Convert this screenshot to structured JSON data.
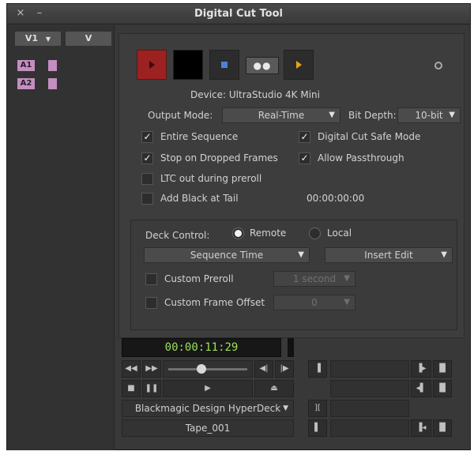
{
  "window": {
    "title": "Digital Cut Tool",
    "close_icon": "×",
    "minimize_icon": "–"
  },
  "tracks": {
    "video_button": "V1",
    "video_source": "V",
    "audio": [
      "A1",
      "A2"
    ]
  },
  "device": "Device: UltraStudio 4K Mini",
  "output_mode": {
    "label": "Output Mode:",
    "value": "Real-Time"
  },
  "bit_depth": {
    "label": "Bit Depth:",
    "value": "10-bit"
  },
  "options": {
    "entire_sequence": {
      "label": "Entire Sequence",
      "checked": true
    },
    "digital_cut_safe_mode": {
      "label": "Digital Cut Safe Mode",
      "checked": true
    },
    "stop_on_dropped_frames": {
      "label": "Stop on Dropped Frames",
      "checked": true
    },
    "allow_passthrough": {
      "label": "Allow Passthrough",
      "checked": true
    },
    "ltc_out": {
      "label": "LTC out during preroll",
      "checked": false
    },
    "add_black": {
      "label": "Add Black at Tail",
      "checked": false,
      "timecode": "00:00:00:00"
    }
  },
  "deck": {
    "label": "Deck Control:",
    "remote": "Remote",
    "local": "Local",
    "selected": "Remote",
    "time_mode": "Sequence Time",
    "edit_mode": "Insert Edit",
    "custom_preroll": {
      "label": "Custom Preroll",
      "value": "1 second"
    },
    "custom_frame_offset": {
      "label": "Custom Frame Offset",
      "value": "0"
    }
  },
  "transport": {
    "timecode": "00:00:11:29",
    "device_name": "Blackmagic Design HyperDeck",
    "tape": "Tape_001"
  },
  "colors": {
    "record": "#9c2222",
    "timecode": "#9be05a",
    "track": "#c48ec0",
    "play": "#e8a21c",
    "stop": "#4a84d8"
  }
}
